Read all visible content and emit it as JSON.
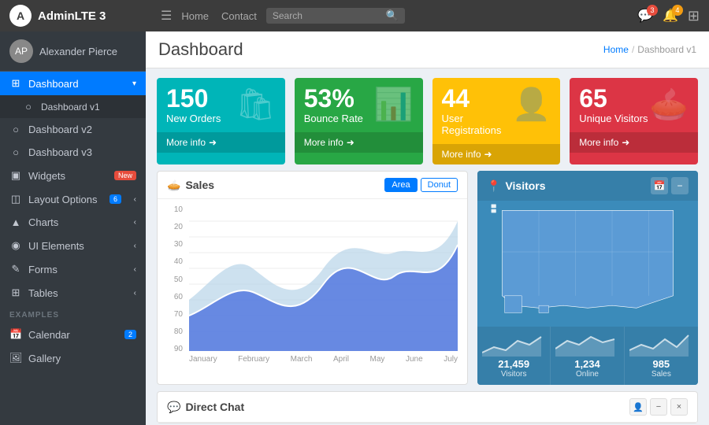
{
  "app": {
    "name": "AdminLTE 3",
    "logo_char": "A"
  },
  "topnav": {
    "hamburger": "☰",
    "links": [
      "Home",
      "Contact"
    ],
    "search_placeholder": "Search",
    "right_icons": {
      "chat_badge": "3",
      "bell_badge": "4",
      "grid_icon": "⊞"
    }
  },
  "sidebar": {
    "user": {
      "name": "Alexander Pierce",
      "avatar_char": "AP"
    },
    "nav_items": [
      {
        "id": "dashboard",
        "label": "Dashboard",
        "icon": "⊞",
        "active": true,
        "has_arrow": true
      },
      {
        "id": "dashboard-v1",
        "label": "Dashboard v1",
        "icon": "○",
        "sub": true
      },
      {
        "id": "dashboard-v2",
        "label": "Dashboard v2",
        "icon": "○"
      },
      {
        "id": "dashboard-v3",
        "label": "Dashboard v3",
        "icon": "○"
      },
      {
        "id": "widgets",
        "label": "Widgets",
        "icon": "▣",
        "badge": "New",
        "badge_color": "red"
      },
      {
        "id": "layout-options",
        "label": "Layout Options",
        "icon": "◫",
        "badge": "6",
        "badge_color": "blue",
        "has_arrow": true
      },
      {
        "id": "charts",
        "label": "Charts",
        "icon": "▲",
        "has_arrow": true
      },
      {
        "id": "ui-elements",
        "label": "UI Elements",
        "icon": "◉",
        "has_arrow": true
      },
      {
        "id": "forms",
        "label": "Forms",
        "icon": "✎",
        "has_arrow": true
      },
      {
        "id": "tables",
        "label": "Tables",
        "icon": "⊞",
        "has_arrow": true
      }
    ],
    "examples_label": "EXAMPLES",
    "examples_items": [
      {
        "id": "calendar",
        "label": "Calendar",
        "icon": "📅",
        "badge": "2",
        "badge_color": "blue"
      },
      {
        "id": "gallery",
        "label": "Gallery",
        "icon": "🖼"
      }
    ]
  },
  "content": {
    "title": "Dashboard",
    "breadcrumb": {
      "home": "Home",
      "current": "Dashboard v1"
    }
  },
  "stat_cards": [
    {
      "num": "150",
      "label": "New Orders",
      "icon": "🛍",
      "footer": "More info",
      "color_class": "card-teal"
    },
    {
      "num": "53%",
      "label": "Bounce Rate",
      "icon": "📊",
      "footer": "More info",
      "color_class": "card-green"
    },
    {
      "num": "44",
      "label": "User Registrations",
      "icon": "👤",
      "footer": "More info",
      "color_class": "card-yellow"
    },
    {
      "num": "65",
      "label": "Unique Visitors",
      "icon": "🥧",
      "footer": "More info",
      "color_class": "card-red"
    }
  ],
  "sales_chart": {
    "title": "Sales",
    "btn_area": "Area",
    "btn_donut": "Donut",
    "y_labels": [
      "10",
      "20",
      "30",
      "40",
      "50",
      "60",
      "70",
      "80",
      "90"
    ],
    "x_labels": [
      "January",
      "February",
      "March",
      "April",
      "May",
      "June",
      "July"
    ]
  },
  "visitors_card": {
    "title": "Visitors",
    "stats": [
      {
        "label": "Visitors",
        "num": "21,459"
      },
      {
        "label": "Online",
        "num": "1,234"
      },
      {
        "label": "Sales",
        "num": "985"
      }
    ]
  },
  "direct_chat": {
    "title": "Direct Chat"
  }
}
